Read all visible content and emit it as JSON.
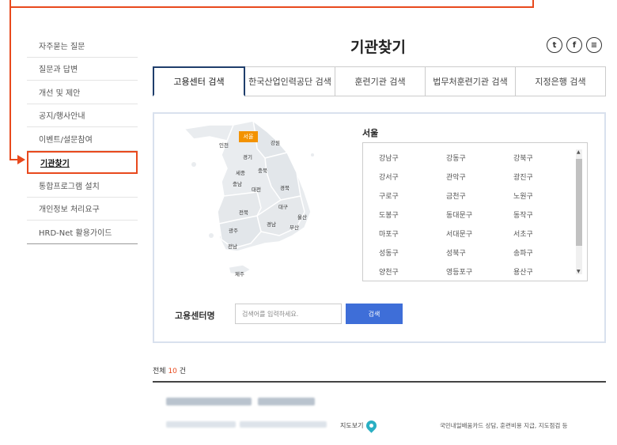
{
  "sidebar": {
    "items": [
      {
        "label": "자주묻는 질문"
      },
      {
        "label": "질문과 답변"
      },
      {
        "label": "개선 및 제안"
      },
      {
        "label": "공지/행사안내"
      },
      {
        "label": "이벤트/설문참여"
      },
      {
        "label": "기관찾기"
      },
      {
        "label": "통합프로그램 설치"
      },
      {
        "label": "개인정보 처리요구"
      },
      {
        "label": "HRD-Net 활용가이드"
      }
    ]
  },
  "header": {
    "title": "기관찾기",
    "social": {
      "twitter": "t",
      "facebook": "f",
      "share": "≡"
    }
  },
  "tabs": [
    {
      "label": "고용센터 검색",
      "active": true
    },
    {
      "label": "한국산업인력공단 검색"
    },
    {
      "label": "훈련기관 검색"
    },
    {
      "label": "법무처훈련기관 검색"
    },
    {
      "label": "지정은행 검색"
    }
  ],
  "map": {
    "regions": {
      "seoul": "서울",
      "incheon": "인천",
      "gangwon": "강원",
      "gyeonggi": "경기",
      "sejong": "세종",
      "chungbuk": "충북",
      "chungnam": "충남",
      "daejeon": "대전",
      "gyeongbuk": "경북",
      "daegu": "대구",
      "jeonbuk": "전북",
      "ulsan": "울산",
      "gyeongnam": "경남",
      "busan": "부산",
      "gwangju": "광주",
      "jeonnam": "전남",
      "jeju": "제주"
    },
    "highlight_color": "#f39200"
  },
  "district_panel": {
    "title": "서울",
    "districts": [
      "강남구",
      "강동구",
      "강북구",
      "강서구",
      "관악구",
      "광진구",
      "구로구",
      "금천구",
      "노원구",
      "도봉구",
      "동대문구",
      "동작구",
      "마포구",
      "서대문구",
      "서초구",
      "성동구",
      "성북구",
      "송파구",
      "양천구",
      "영등포구",
      "용산구"
    ]
  },
  "search": {
    "label": "고용센터명",
    "placeholder": "검색어를 입력하세요.",
    "button": "검색"
  },
  "results": {
    "total_prefix": "전체",
    "total_count": "10",
    "total_suffix": "건",
    "map_link": "지도보기",
    "services": "국민내일배움카드 상담, 훈련비용 지급, 지도점검 등"
  },
  "colors": {
    "accent": "#e8491d",
    "primary_button": "#3e6ed8",
    "tab_active_border": "#1f3e6c"
  }
}
